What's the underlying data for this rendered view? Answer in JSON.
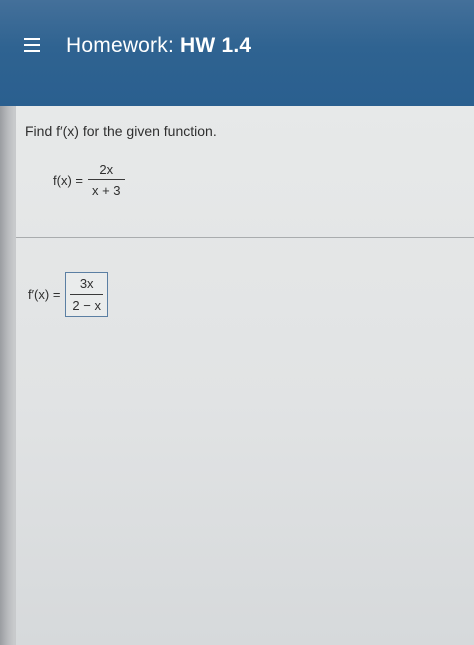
{
  "header": {
    "title_prefix": "Homework:",
    "title_bold": "HW 1.4"
  },
  "question": {
    "prompt": "Find f′(x) for the given function.",
    "function_lhs": "f(x) =",
    "function_numerator": "2x",
    "function_denominator": "x + 3"
  },
  "answer": {
    "lhs": "f′(x) =",
    "numerator": "3x",
    "denominator": "2 − x"
  },
  "colors": {
    "header_bg": "#2a5f8f",
    "answer_border": "#5b7fa3"
  },
  "icons": {
    "menu": "hamburger-menu-icon"
  }
}
